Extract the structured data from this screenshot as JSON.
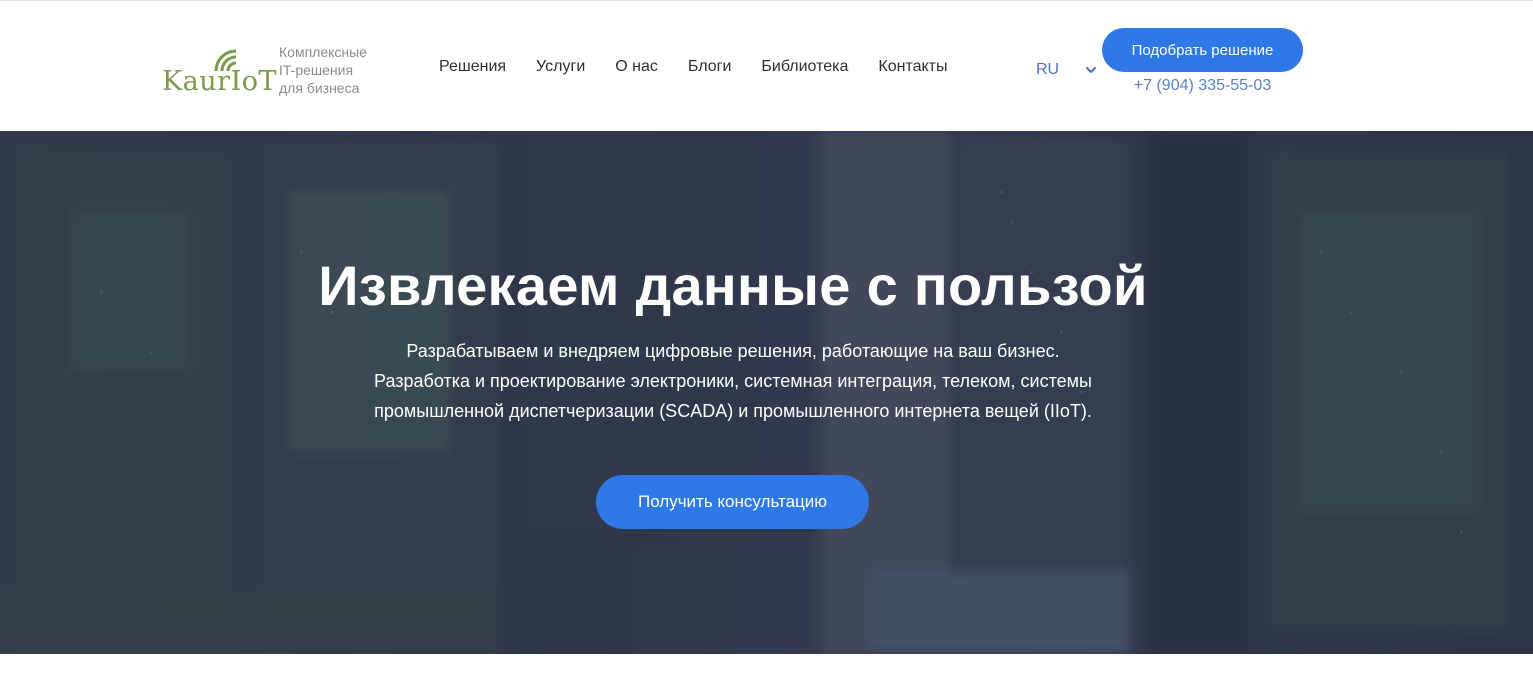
{
  "brand": {
    "logo_text": "KaurIoT",
    "tagline": [
      "Комплексные",
      "IT-решения",
      "для бизнеса"
    ],
    "logo_color": "#7a9a4a"
  },
  "nav": {
    "items": [
      {
        "label": "Решения"
      },
      {
        "label": "Услуги"
      },
      {
        "label": "О нас"
      },
      {
        "label": "Блоги"
      },
      {
        "label": "Библиотека"
      },
      {
        "label": "Контакты"
      }
    ]
  },
  "language": {
    "selected": "RU",
    "icon": "chevron-down-icon"
  },
  "header_cta": {
    "label": "Подобрать решение",
    "phone": "+7 (904) 335-55-03"
  },
  "hero": {
    "title": "Извлекаем данные с пользой",
    "subtitle_lines": [
      "Разрабатываем и внедряем цифровые решения, работающие на ваш бизнес.",
      "Разработка и проектирование электроники, системная интеграция, телеком, системы",
      "промышленной диспетчеризации (SCADA) и промышленного интернета вещей (IIoT)."
    ],
    "cta_label": "Получить консультацию"
  },
  "colors": {
    "accent": "#2f78e8",
    "link_blue": "#5b7fc8",
    "hero_overlay": "#3a3f52"
  }
}
